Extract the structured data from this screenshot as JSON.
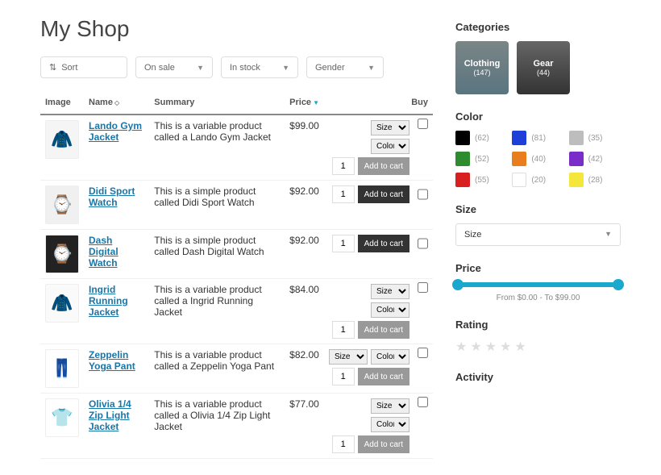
{
  "title": "My Shop",
  "controls": {
    "sort": "Sort",
    "filters": [
      "On sale",
      "In stock",
      "Gender"
    ]
  },
  "table": {
    "headers": {
      "image": "Image",
      "name": "Name",
      "summary": "Summary",
      "price": "Price",
      "buy": "Buy"
    },
    "rows": [
      {
        "icon": "🧥",
        "bg": "#f5f5f5",
        "name": "Lando Gym Jacket",
        "summary": "This is a variable product called a Lando Gym Jacket",
        "price": "$99.00",
        "variable": true,
        "stacked": true,
        "qty": "1",
        "btn": "Add to cart"
      },
      {
        "icon": "⌚",
        "bg": "#f0f0f0",
        "name": "Didi Sport Watch",
        "summary": "This is a simple product called Didi Sport Watch",
        "price": "$92.00",
        "variable": false,
        "qty": "1",
        "btn": "Add to cart"
      },
      {
        "icon": "⌚",
        "bg": "#222",
        "name": "Dash Digital Watch",
        "summary": "This is a simple product called Dash Digital Watch",
        "price": "$92.00",
        "variable": false,
        "qty": "1",
        "btn": "Add to cart"
      },
      {
        "icon": "🧥",
        "bg": "#fafafa",
        "name": "Ingrid Running Jacket",
        "summary": "This is a variable product called a Ingrid Running Jacket",
        "price": "$84.00",
        "variable": true,
        "stacked": true,
        "qty": "1",
        "btn": "Add to cart"
      },
      {
        "icon": "👖",
        "bg": "#fff",
        "name": "Zeppelin Yoga Pant",
        "summary": "This is a variable product called a Zeppelin Yoga Pant",
        "price": "$82.00",
        "variable": true,
        "stacked": false,
        "qty": "1",
        "btn": "Add to cart"
      },
      {
        "icon": "👕",
        "bg": "#fff",
        "name": "Olivia 1/4 Zip Light Jacket",
        "summary": "This is a variable product called a Olivia 1/4 Zip Light Jacket",
        "price": "$77.00",
        "variable": true,
        "stacked": true,
        "qty": "1",
        "btn": "Add to cart"
      }
    ],
    "size_opt": "Size",
    "color_opt": "Color"
  },
  "sidebar": {
    "categories_title": "Categories",
    "categories": [
      {
        "name": "Clothing",
        "count": "(147)"
      },
      {
        "name": "Gear",
        "count": "(44)"
      }
    ],
    "color_title": "Color",
    "colors": [
      {
        "hex": "#000000",
        "count": "(62)"
      },
      {
        "hex": "#1e40d8",
        "count": "(81)"
      },
      {
        "hex": "#bdbdbd",
        "count": "(35)"
      },
      {
        "hex": "#2e8b2e",
        "count": "(52)"
      },
      {
        "hex": "#e87e1e",
        "count": "(40)"
      },
      {
        "hex": "#7a2ec9",
        "count": "(42)"
      },
      {
        "hex": "#d82020",
        "count": "(55)"
      },
      {
        "hex": "#ffffff",
        "count": "(20)",
        "border": true
      },
      {
        "hex": "#f5e63c",
        "count": "(28)"
      }
    ],
    "size_title": "Size",
    "size_placeholder": "Size",
    "price_title": "Price",
    "price_text": "From $0.00 - To $99.00",
    "rating_title": "Rating",
    "activity_title": "Activity"
  }
}
